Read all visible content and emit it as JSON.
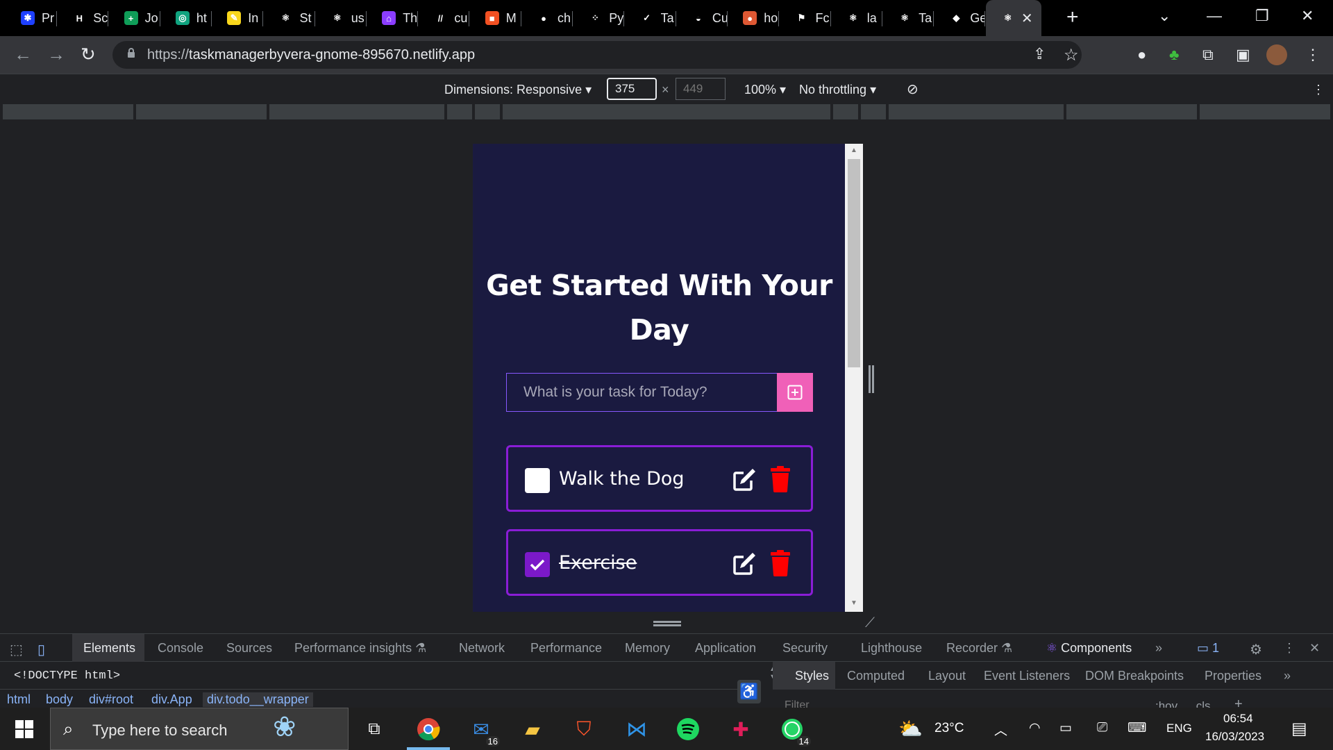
{
  "browser": {
    "tabs": [
      {
        "title": "Pr",
        "icon": "figma-icon",
        "color": "#1e40ff",
        "glyph": "✱"
      },
      {
        "title": "Sc",
        "icon": "hackerrank-icon",
        "color": "#000000",
        "glyph": "H"
      },
      {
        "title": "Jo",
        "icon": "sheets-icon",
        "color": "#0f9d58",
        "glyph": "+"
      },
      {
        "title": "ht",
        "icon": "chatgpt-icon",
        "color": "#10a37f",
        "glyph": "◎"
      },
      {
        "title": "In",
        "icon": "pencil-icon",
        "color": "#f9d71c",
        "glyph": "✎"
      },
      {
        "title": "St",
        "icon": "react-icon",
        "color": "#000000",
        "glyph": "⚛"
      },
      {
        "title": "us",
        "icon": "react-icon",
        "color": "#000000",
        "glyph": "⚛"
      },
      {
        "title": "Th",
        "icon": "shield-icon",
        "color": "#8b3dff",
        "glyph": "⌂"
      },
      {
        "title": "cu",
        "icon": "slash-icon",
        "color": "#000000",
        "glyph": "//"
      },
      {
        "title": "M",
        "icon": "microsoft-icon",
        "color": "#f25022",
        "glyph": "■"
      },
      {
        "title": "ch",
        "icon": "github-icon",
        "color": "#000000",
        "glyph": "●"
      },
      {
        "title": "Py",
        "icon": "dots-icon",
        "color": "#000000",
        "glyph": "⁘"
      },
      {
        "title": "Ta",
        "icon": "check-icon",
        "color": "#000000",
        "glyph": "✓"
      },
      {
        "title": "Cu",
        "icon": "dome-icon",
        "color": "#000000",
        "glyph": "◒"
      },
      {
        "title": "ho",
        "icon": "duckduckgo-icon",
        "color": "#de5833",
        "glyph": "●"
      },
      {
        "title": "Fc",
        "icon": "flag-icon",
        "color": "#000000",
        "glyph": "⚑"
      },
      {
        "title": "la",
        "icon": "react-icon",
        "color": "#000000",
        "glyph": "⚛"
      },
      {
        "title": "Ta",
        "icon": "react-icon",
        "color": "#000000",
        "glyph": "⚛"
      },
      {
        "title": "Ge",
        "icon": "diamond-icon",
        "color": "#000000",
        "glyph": "◆"
      },
      {
        "title": "",
        "icon": "react-icon",
        "color": "#35363a",
        "glyph": "⚛"
      }
    ],
    "url_scheme": "https://",
    "url_host": "taskmanagerbyvera-gnome-895670.netlify.app"
  },
  "device_toolbar": {
    "dimensions_label": "Dimensions: Responsive",
    "width": "375",
    "height_placeholder": "449",
    "times": "×",
    "zoom": "100%",
    "throttling": "No throttling"
  },
  "app": {
    "title": "Get Started With Your Day",
    "input_placeholder": "What is your task for Today?",
    "todos": [
      {
        "text": "Walk the Dog",
        "completed": false
      },
      {
        "text": "Exercise",
        "completed": true
      }
    ],
    "colors": {
      "background": "#1a1a40",
      "border": "#8a1dd6",
      "add_button": "#f060b8",
      "delete_icon": "#ff0000",
      "checked": "#7b19c9"
    }
  },
  "devtools": {
    "tabs": [
      "Elements",
      "Console",
      "Sources",
      "Performance insights ⚗",
      "Network",
      "Performance",
      "Memory",
      "Application",
      "Security",
      "Lighthouse",
      "Recorder ⚗",
      "Components"
    ],
    "issues_count": "1",
    "doctype": "<!DOCTYPE html>",
    "breadcrumbs": [
      "html",
      "body",
      "div#root",
      "div.App",
      "div.todo__wrapper"
    ],
    "styles_tabs": [
      "Styles",
      "Computed",
      "Layout",
      "Event Listeners",
      "DOM Breakpoints",
      "Properties"
    ],
    "filter_placeholder": "Filter",
    "hov": ":hov",
    "cls": ".cls"
  },
  "taskbar": {
    "search_placeholder": "Type here to search",
    "mail_badge": "16",
    "whatsapp_badge": "14",
    "temperature": "23°C",
    "language": "ENG",
    "time": "06:54",
    "date": "16/03/2023"
  }
}
